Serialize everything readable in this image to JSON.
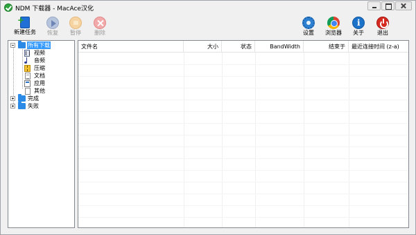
{
  "window": {
    "title": "NDM 下载器 - MacAce汉化"
  },
  "toolbar": {
    "new_task": "新建任务",
    "resume": "恢复",
    "pause": "暂停",
    "delete": "删除",
    "settings": "设置",
    "browser": "浏览器",
    "about": "关于",
    "exit": "退出"
  },
  "tree": {
    "root": "所有下载",
    "categories": [
      "视频",
      "音频",
      "压缩",
      "文档",
      "应用",
      "其他"
    ],
    "completed": "完成",
    "failed": "失败"
  },
  "list": {
    "columns": [
      "文件名",
      "大小",
      "状态",
      "BandWidth",
      "结束于",
      "最近连接时间 (z-a)"
    ]
  }
}
